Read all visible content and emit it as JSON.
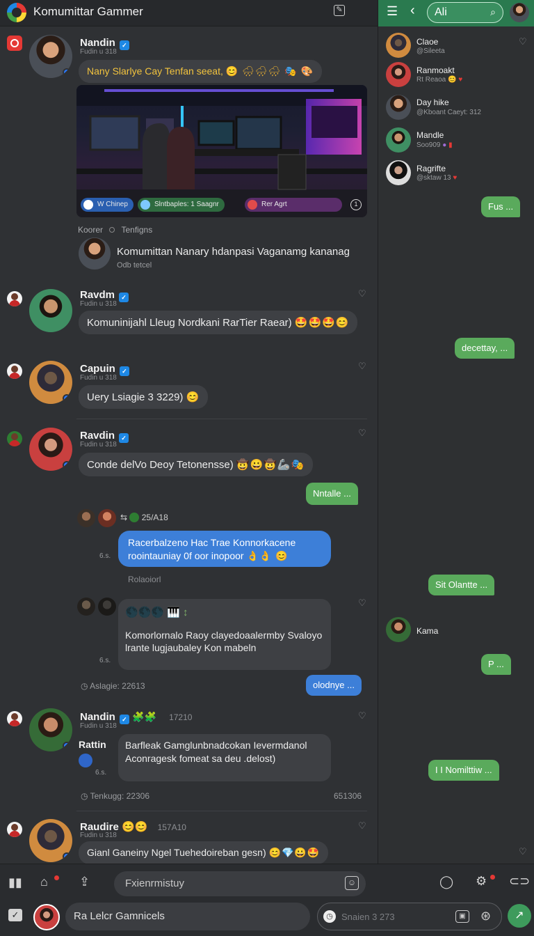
{
  "app": {
    "title": "Komumittar Gammer"
  },
  "feed": {
    "post1": {
      "author": "Nandin",
      "handle": "Fudin u 318",
      "text": "Nany Slarlye Cay Tenfan seeat,",
      "text_emojis": "😊 🌧🌧🌧 🎭 🎨",
      "chips": [
        "W Chinep",
        "Slntbaples: 1 Saagnr",
        "Rer Agrt"
      ],
      "timer_label": "1"
    },
    "comment": {
      "label_a": "Koorer",
      "label_b": "Tenfigns",
      "text": "Komumittan Nanary hdanpasi Vaganamg kananag",
      "sub": "Odb tetcel"
    },
    "post2": {
      "author": "Ravdm",
      "handle": "Fudin u 318",
      "text": "Komuninijahl Lleug Nordkani RarTier Raear)",
      "emojis": "🤩🤩🤩😊"
    },
    "post3": {
      "author": "Capuin",
      "handle": "Fudin u 318",
      "text": "Uery Lsiagie 3 3229)",
      "emojis": "😊"
    },
    "post4": {
      "author": "Ravdin",
      "handle": "Fudin u 318",
      "text": "Conde delVo Deoy Tetonensse)",
      "emojis": "🤠😀🤠🦾🎭"
    },
    "reply_green_1": "Nntalle ...",
    "thread": {
      "meta": "25/A18",
      "blue_text_1": "Racerbalzeno Hac Trae Konnorkacene",
      "blue_text_2": "roointauniay 0f oor inopoor",
      "blue_emojis": "👌👌 😊",
      "mini_label": "6.s.",
      "reply_label": "Rolaoiorl",
      "gray_emojis": "🌑🌑🌑 🎹 ↕",
      "gray_text_1": "Komorlornalo Raoy clayedoaalermby Svaloyo",
      "gray_text_2": "lrante lugjaubaley Kon mabeln",
      "gray_mini": "6.s.",
      "time_label": "Aslagie: 22613",
      "reply_blue_small": "olodnye ..."
    },
    "post5": {
      "author": "Nandin",
      "handle": "Fudin u 318",
      "time": "17210",
      "side_label": "Rattin",
      "text_1": "Barfleak Gamglunbnadcokan Ievermdanol",
      "text_2": "Aconragesk fomeat sa deu .delost)",
      "mini": "6.s.",
      "footer_left": "Tenkugg: 22306",
      "footer_right": "651306"
    },
    "post6": {
      "author": "Raudire",
      "handle": "Fudin u 318",
      "time": "157A10",
      "text": "Gianl Ganeiny Ngel Tuehedoireban gesn)",
      "emojis": "😊💎😀🤩"
    }
  },
  "right_panel": {
    "search_placeholder": "Ali",
    "contacts": [
      {
        "name": "Claoe",
        "handle": "@Sileeta"
      },
      {
        "name": "Ranmoakt",
        "handle": "Rt Reaoa"
      },
      {
        "name": "Day hike",
        "handle": "@Kboant Caeyt: 312"
      },
      {
        "name": "Mandle",
        "handle": "Soo909"
      },
      {
        "name": "Ragrifte",
        "handle": "@sktaw 13"
      }
    ],
    "messages": [
      "Fus ...",
      "decettay, ...",
      "Sit Olantte ...",
      "P ...",
      "I I Nomilttiw ..."
    ],
    "contact_k": "Kama"
  },
  "composer": {
    "placeholder_top": "Fxienrmistuy",
    "placeholder_bottom": "Ra Lelcr Gamnicels",
    "search_placeholder": "Snaien 3 273"
  },
  "colors": {
    "accent_green": "#2a7a4f",
    "bubble_green": "#5aaa5c",
    "bubble_blue": "#3d7fd8",
    "verified": "#1e88e5"
  }
}
